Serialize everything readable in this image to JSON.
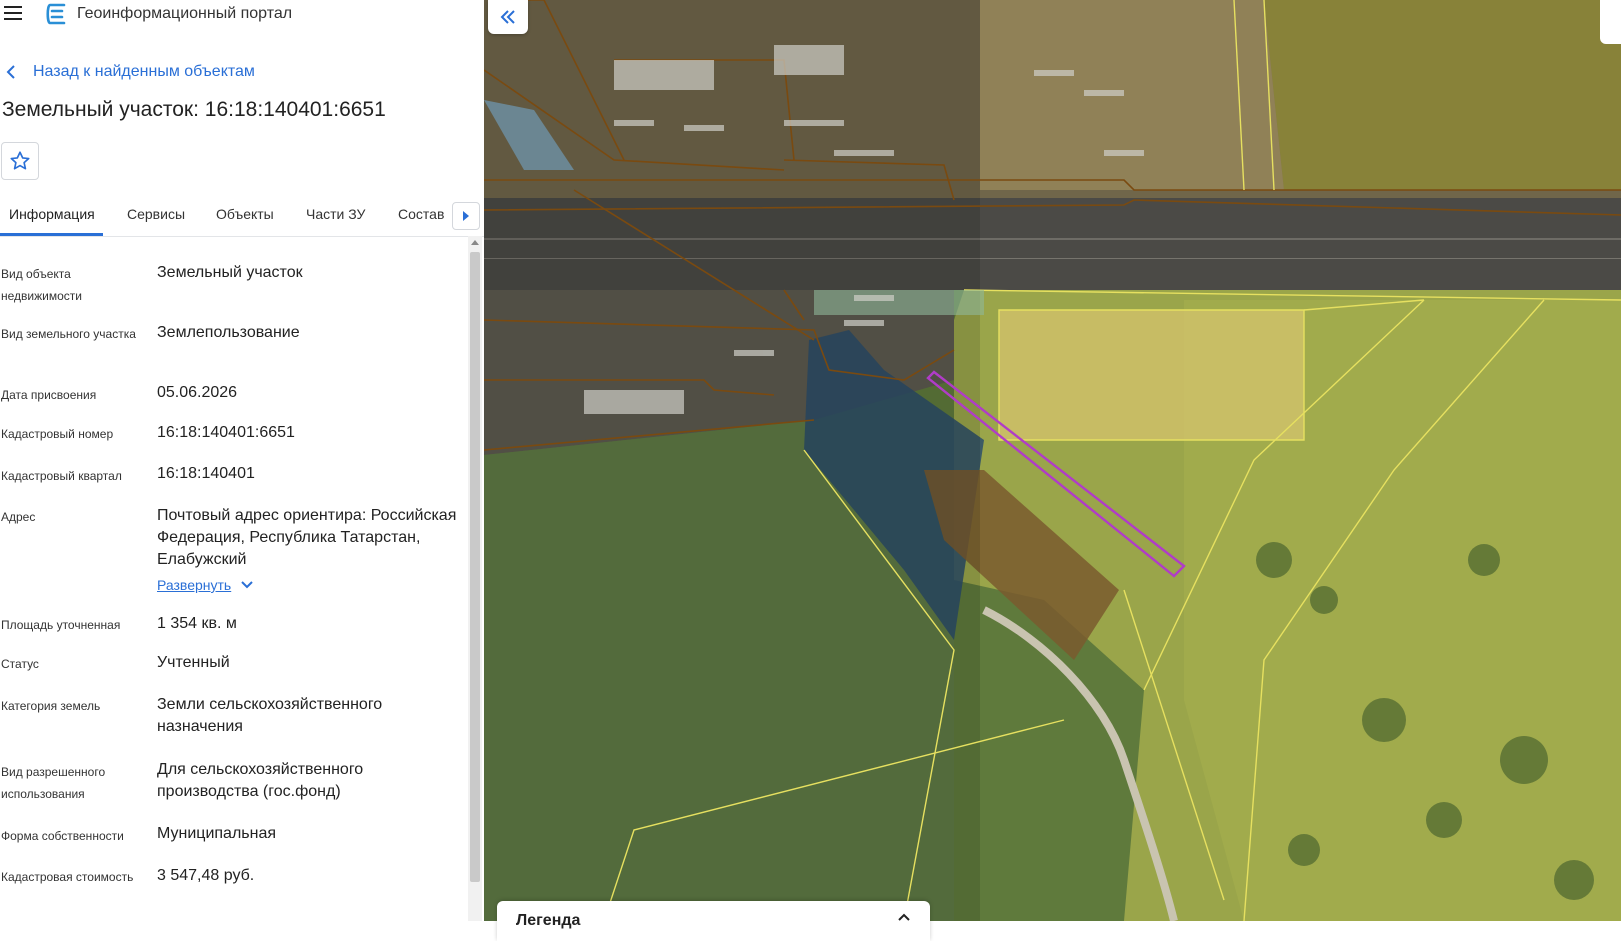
{
  "header": {
    "app_title": "Геоинформационный портал"
  },
  "back_link": "Назад к найденным объектам",
  "object_title": "Земельный участок: 16:18:140401:6651",
  "tabs": [
    "Информация",
    "Сервисы",
    "Объекты",
    "Части ЗУ",
    "Состав"
  ],
  "fields": [
    {
      "label": "Вид объекта недвижимости",
      "value": "Земельный участок"
    },
    {
      "label": "Вид земельного участка",
      "value": "Землепользование"
    },
    {
      "label": "Дата присвоения",
      "value": "05.06.2026"
    },
    {
      "label": "Кадастровый номер",
      "value": "16:18:140401:6651"
    },
    {
      "label": "Кадастровый квартал",
      "value": "16:18:140401"
    },
    {
      "label": "Адрес",
      "value": "Почтовый адрес ориентира: Российская Федерация, Республика Татарстан, Елабужский"
    },
    {
      "label": "Площадь уточненная",
      "value": "1 354 кв. м"
    },
    {
      "label": "Статус",
      "value": "Учтенный"
    },
    {
      "label": "Категория земель",
      "value": "Земли сельскохозяйственного назначения"
    },
    {
      "label": "Вид разрешенного использования",
      "value": "Для сельскохозяйственного производства (гос.фонд)"
    },
    {
      "label": "Форма собственности",
      "value": "Муниципальная"
    },
    {
      "label": "Кадастровая стоимость",
      "value": "3 547,48 руб."
    }
  ],
  "expand_label": "Развернуть",
  "legend": {
    "title": "Легенда"
  },
  "colors": {
    "accent": "#2a6fd6",
    "parcel_outline": "#b03cc8",
    "boundary_brown": "#7a4a10",
    "boundary_yellow": "#e6e060"
  },
  "icons": [
    "menu-icon",
    "portal-logo-icon",
    "chevron-left-icon",
    "star-icon",
    "caret-right-icon",
    "chevron-down-icon",
    "double-chevron-left-icon",
    "chevron-up-icon"
  ]
}
